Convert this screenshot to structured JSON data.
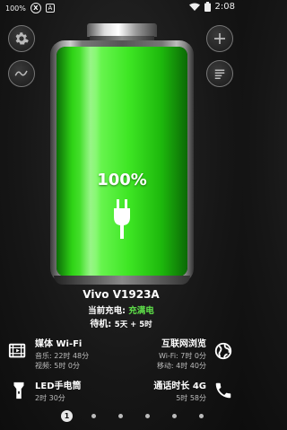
{
  "status_bar": {
    "battery_percent": "100%",
    "icon1": "X",
    "icon2": "A",
    "time": "2:08"
  },
  "battery": {
    "percent_text": "100%",
    "level": 1.0,
    "fill_color": "#3ee624"
  },
  "device": {
    "name": "Vivo V1923A",
    "charge_label": "当前充电:",
    "charge_value": "充满电",
    "standby_label": "待机:",
    "standby_value": "5天 + 5时"
  },
  "stats": {
    "media": {
      "title": "媒体 Wi-Fi",
      "line1": "音乐: 22时 48分",
      "line2": "视频: 5时 0分"
    },
    "browse": {
      "title": "互联网浏览",
      "line1": "Wi-Fi: 7时 0分",
      "line2": "移动: 4时 40分"
    },
    "flashlight": {
      "title": "LED手电筒",
      "line1": "2时 30分"
    },
    "talk": {
      "title": "通话时长 4G",
      "line1": "5时 58分"
    }
  },
  "pager": {
    "current": "1",
    "count": 6
  },
  "icons": {
    "settings": "gear-icon",
    "graph": "graph-icon",
    "add": "plus-icon",
    "menu": "menu-icon",
    "media": "film-icon",
    "browse": "globe-icon",
    "flashlight": "flashlight-icon",
    "phone": "phone-icon",
    "plug": "plug-icon"
  },
  "colors": {
    "accent_green": "#5fe34a"
  }
}
